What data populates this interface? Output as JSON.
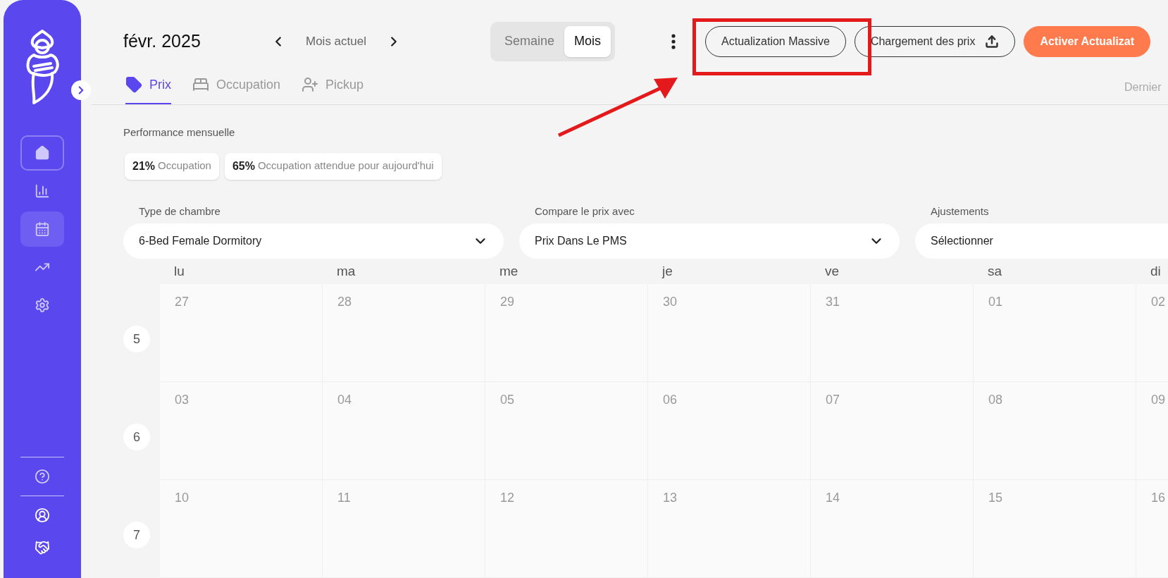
{
  "sidebar": {
    "items": [
      {
        "focused": true,
        "selected": false
      },
      {
        "focused": false,
        "selected": false
      },
      {
        "focused": false,
        "selected": true
      },
      {
        "focused": false,
        "selected": false
      },
      {
        "focused": false,
        "selected": false
      }
    ],
    "footer_items": [
      {
        "selected": false
      },
      {
        "selected": false
      },
      {
        "selected": false
      }
    ]
  },
  "header": {
    "title": "févr. 2025",
    "current_label": "Mois actuel",
    "view_toggle": [
      {
        "label": "Semaine",
        "selected": false
      },
      {
        "label": "Mois",
        "selected": true
      }
    ],
    "actions": [
      {
        "label": "Actualization Massive",
        "kind": "outline"
      },
      {
        "label": "Chargement des prix",
        "kind": "upload"
      },
      {
        "label": "Activer Actualizat",
        "kind": "primary"
      }
    ]
  },
  "tabs": [
    {
      "label": "Prix",
      "selected": true
    },
    {
      "label": "Occupation",
      "selected": false
    },
    {
      "label": "Pickup",
      "selected": false
    }
  ],
  "last_update": "Dernier",
  "performance": {
    "title": "Performance mensuelle",
    "stats": [
      {
        "value": "21%",
        "label": "Occupation"
      },
      {
        "value": "65%",
        "label": "Occupation attendue pour aujourd'hui"
      }
    ]
  },
  "filters": [
    {
      "label": "Type de chambre",
      "value": "6-Bed Female Dormitory"
    },
    {
      "label": "Compare le prix avec",
      "value": "Prix Dans Le PMS"
    },
    {
      "label": "Ajustements",
      "value": "Sélectionner"
    }
  ],
  "calendar": {
    "weekdays": [
      "lu",
      "ma",
      "me",
      "je",
      "ve",
      "sa",
      "di"
    ],
    "weeks": [
      {
        "number": "5",
        "days": [
          "27",
          "28",
          "29",
          "30",
          "31",
          "01",
          "02"
        ]
      },
      {
        "number": "6",
        "days": [
          "03",
          "04",
          "05",
          "06",
          "07",
          "08",
          "09"
        ]
      },
      {
        "number": "7",
        "days": [
          "10",
          "11",
          "12",
          "13",
          "14",
          "15",
          "16"
        ]
      }
    ]
  }
}
